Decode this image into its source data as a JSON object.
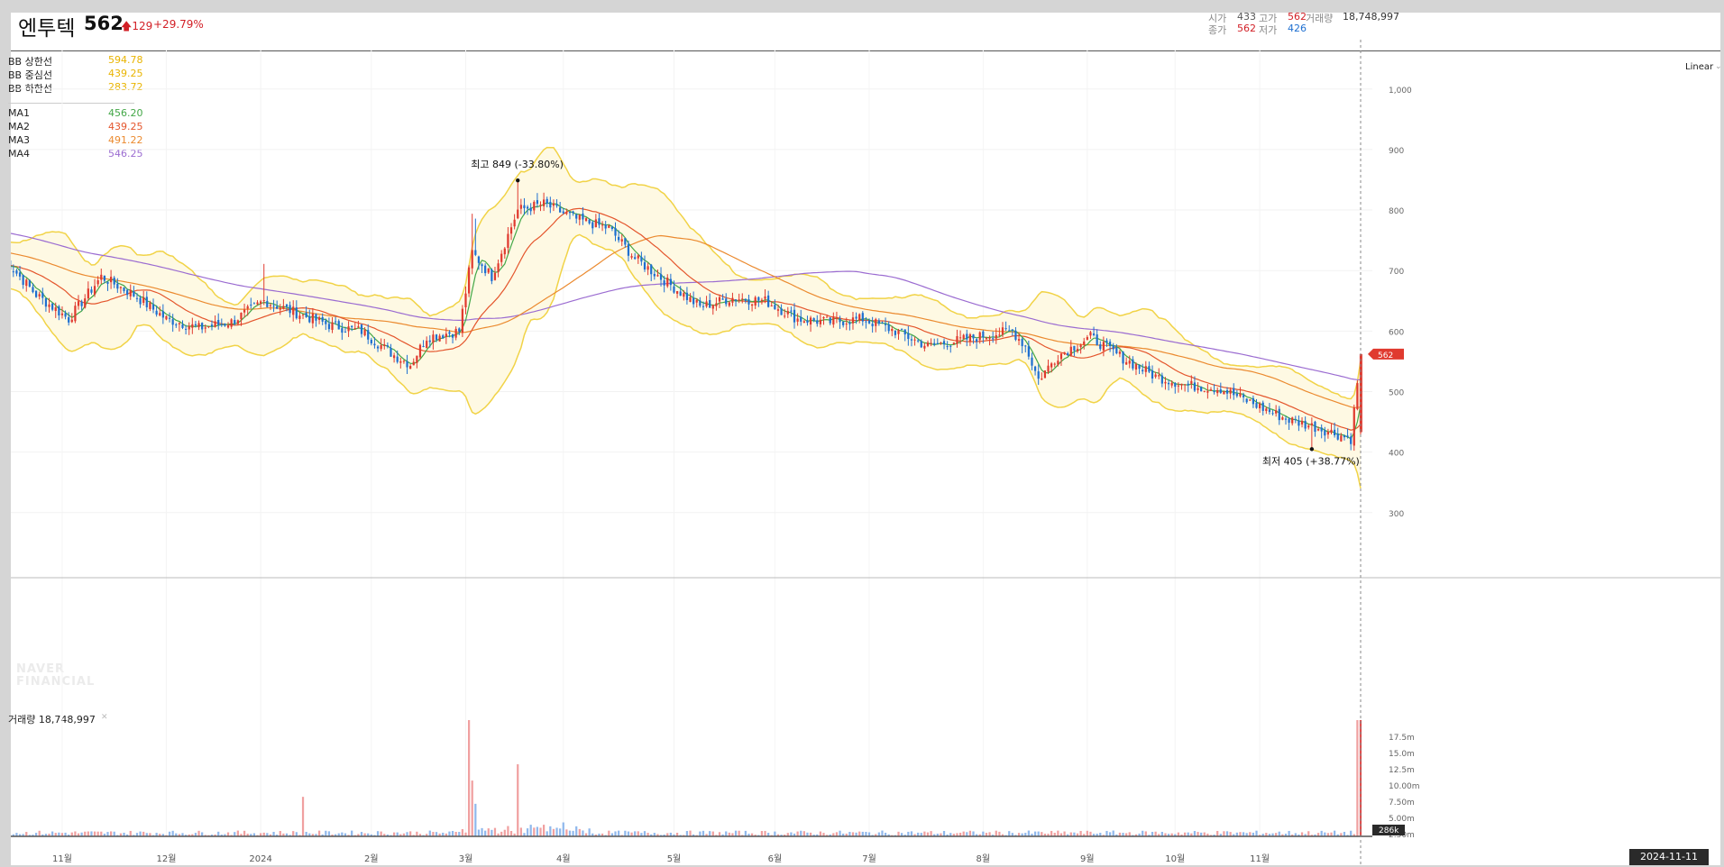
{
  "header": {
    "name": "엔투텍",
    "price": "562",
    "change": "129",
    "change_pct": "+29.79%",
    "open_label": "시가",
    "open": "433",
    "high_label": "고가",
    "high": "562",
    "volume_label": "거래량",
    "volume": "18,748,997",
    "close_label": "종가",
    "close": "562",
    "low_label": "저가",
    "low": "426"
  },
  "legend": {
    "bb_upper_label": "BB 상한선",
    "bb_upper": "594.78",
    "bb_mid_label": "BB 중심선",
    "bb_mid": "439.25",
    "bb_lower_label": "BB 하한선",
    "bb_lower": "283.72",
    "ma1_label": "MA1",
    "ma1": "456.20",
    "ma2_label": "MA2",
    "ma2": "439.25",
    "ma3_label": "MA3",
    "ma3": "491.22",
    "ma4_label": "MA4",
    "ma4": "546.25"
  },
  "toolbar": {
    "scale": "Linear"
  },
  "watermark": [
    "NAVER",
    "FINANCIAL"
  ],
  "volume_panel": {
    "label": "거래량",
    "value": "18,748,997",
    "current_tag": "286k"
  },
  "date_tag": "2024-11-11",
  "annotations": {
    "high_label": "최고",
    "high_text": "849 (-33.80%)",
    "low_label": "최저",
    "low_text": "405 (+38.77%)"
  },
  "colors": {
    "up": "#e03a2f",
    "down": "#1e6fd0",
    "bb_band": "#fef9e3",
    "bb_line": "#f1d347",
    "ma1": "#43a747",
    "ma2": "#e4552c",
    "ma3": "#eb8a2f",
    "ma4": "#9b6cd1",
    "vol_up": "#f0a0a0",
    "vol_down": "#90b8ec"
  },
  "chart_data": {
    "type": "candlestick",
    "x_ticks": [
      "11월",
      "12월",
      "2024",
      "2월",
      "3월",
      "4월",
      "5월",
      "6월",
      "7월",
      "8월",
      "9월",
      "10월",
      "11월"
    ],
    "y_ticks": [
      "1,000",
      "900",
      "800",
      "700",
      "600",
      "500",
      "400",
      "300"
    ],
    "ylim": [
      270,
      1080
    ],
    "volume_ticks": [
      "17.5m",
      "15.0m",
      "12.5m",
      "10.00m",
      "7.50m",
      "5.00m",
      "2.50m"
    ],
    "last_price_tag": "562",
    "price_keypoints": [
      [
        0,
        720
      ],
      [
        10,
        660
      ],
      [
        20,
        620
      ],
      [
        30,
        690
      ],
      [
        40,
        660
      ],
      [
        50,
        620
      ],
      [
        60,
        605
      ],
      [
        70,
        615
      ],
      [
        80,
        650
      ],
      [
        90,
        630
      ],
      [
        100,
        610
      ],
      [
        110,
        600
      ],
      [
        120,
        560
      ],
      [
        125,
        545
      ],
      [
        130,
        590
      ],
      [
        140,
        600
      ],
      [
        144,
        730
      ],
      [
        150,
        690
      ],
      [
        158,
        800
      ],
      [
        166,
        810
      ],
      [
        176,
        785
      ],
      [
        186,
        770
      ],
      [
        194,
        720
      ],
      [
        204,
        680
      ],
      [
        214,
        640
      ],
      [
        224,
        655
      ],
      [
        234,
        650
      ],
      [
        244,
        620
      ],
      [
        254,
        615
      ],
      [
        264,
        620
      ],
      [
        274,
        600
      ],
      [
        284,
        575
      ],
      [
        294,
        585
      ],
      [
        304,
        595
      ],
      [
        310,
        600
      ],
      [
        314,
        575
      ],
      [
        318,
        520
      ],
      [
        324,
        560
      ],
      [
        334,
        590
      ],
      [
        344,
        555
      ],
      [
        354,
        525
      ],
      [
        364,
        510
      ],
      [
        374,
        505
      ],
      [
        384,
        480
      ],
      [
        394,
        455
      ],
      [
        404,
        440
      ],
      [
        414,
        422
      ],
      [
        417,
        562
      ]
    ],
    "annotations": [
      {
        "label": "최고",
        "value": 849,
        "pct": "-33.80%",
        "bar": 158
      },
      {
        "label": "최저",
        "value": 405,
        "pct": "+38.77%",
        "bar": 402
      }
    ]
  }
}
